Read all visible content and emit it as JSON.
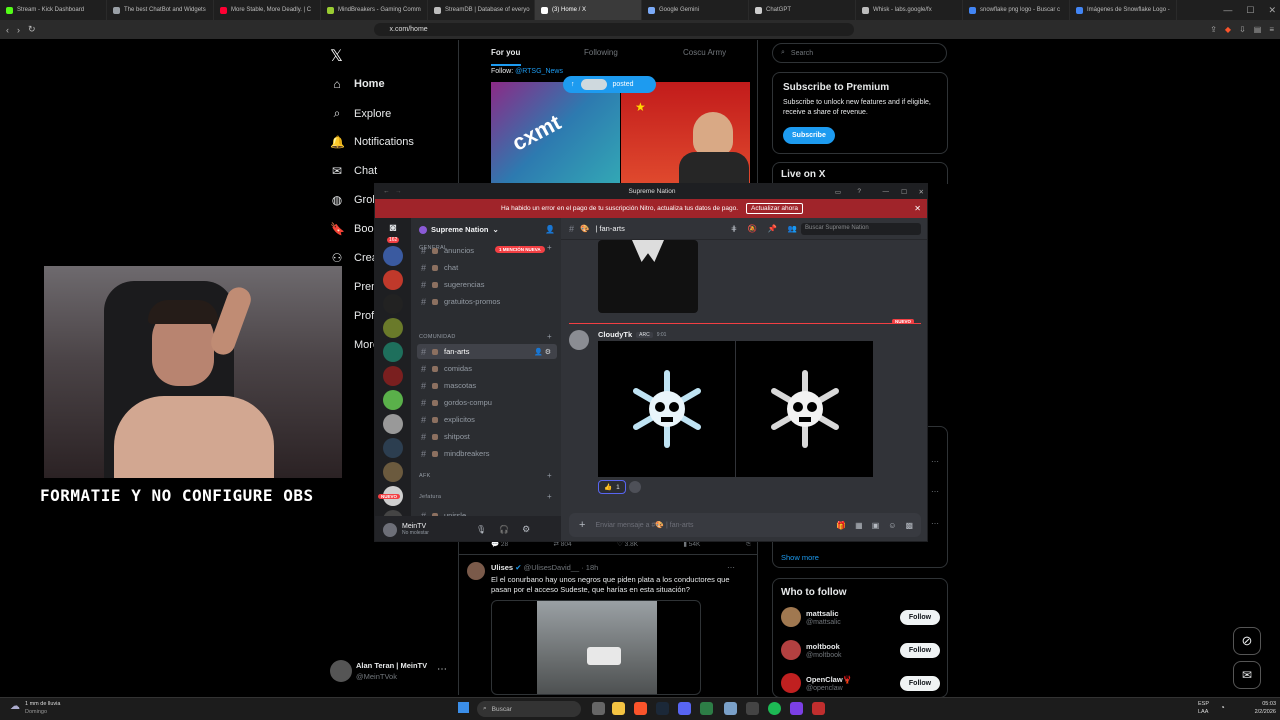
{
  "browser": {
    "tabs": [
      {
        "label": "Stream - Kick Dashboard",
        "color": "#53fc18"
      },
      {
        "label": "The best ChatBot and Widgets",
        "color": "#9aa0a6"
      },
      {
        "label": "More Stable, More Deadly. | C",
        "color": "#ff0033"
      },
      {
        "label": "MindBreakers - Gaming Comm",
        "color": "#9acd32"
      },
      {
        "label": "StreamDB | Database of everyo",
        "color": "#bdbdbd"
      },
      {
        "label": "(3) Home / X",
        "color": "#ffffff"
      },
      {
        "label": "Google Gemini",
        "color": "#7baaf7"
      },
      {
        "label": "ChatGPT",
        "color": "#cccccc"
      },
      {
        "label": "Whisk - labs.google/fx",
        "color": "#bdbdbd"
      },
      {
        "label": "snowflake png logo - Buscar c",
        "color": "#4285f4"
      },
      {
        "label": "Imágenes de Snowflake Logo -",
        "color": "#4285f4"
      }
    ],
    "url": "x.com/home"
  },
  "x": {
    "logo": "𝕏",
    "nav": [
      {
        "label": "Home",
        "icon": "home-icon",
        "glyph": "⌂"
      },
      {
        "label": "Explore",
        "icon": "search-icon",
        "glyph": "⌕"
      },
      {
        "label": "Notifications",
        "icon": "bell-icon",
        "glyph": "🔔"
      },
      {
        "label": "Chat",
        "icon": "mail-icon",
        "glyph": "✉"
      },
      {
        "label": "Grok",
        "icon": "grok-icon",
        "glyph": "◍"
      },
      {
        "label": "Book",
        "icon": "bookmark-icon",
        "glyph": "🔖"
      },
      {
        "label": "Crea",
        "icon": "communities-icon",
        "glyph": "⚇"
      },
      {
        "label": "Prem",
        "icon": "premium-icon",
        "glyph": "𝕏"
      },
      {
        "label": "Profi",
        "icon": "profile-icon",
        "glyph": "☺"
      },
      {
        "label": "More",
        "icon": "more-icon",
        "glyph": "⋯"
      }
    ],
    "account": {
      "name": "Alan Teran | MeinTV",
      "handle": "@MeinTVok"
    },
    "feed_tabs": [
      "For you",
      "Following",
      "Coscu Army"
    ],
    "follow_line": "Follow: ",
    "follow_handle": "@RTSG_News",
    "posted_pill": "posted",
    "tweet_stats": [
      "28",
      "804",
      "3.8K",
      "54K"
    ],
    "tweet2": {
      "name": "Ulises",
      "handle": "@UlisesDavid__ · 18h",
      "text": "El el conurbano hay unos negros que piden plata a los conductores que pasan por el acceso Sudeste, que harías en esta situación?"
    },
    "search_placeholder": "Search",
    "premium": {
      "title": "Subscribe to Premium",
      "text": "Subscribe to unlock new features and if eligible, receive a share of revenue.",
      "button": "Subscribe"
    },
    "live_title": "Live on X",
    "show_more": "Show more",
    "who_to_follow": {
      "title": "Who to follow",
      "follow_label": "Follow",
      "accounts": [
        {
          "name": "mattsalic",
          "handle": "@mattsalic"
        },
        {
          "name": "moltbook",
          "handle": "@moltbook"
        },
        {
          "name": "OpenClaw🦞",
          "handle": "@openclaw"
        }
      ]
    }
  },
  "stream": {
    "caption": "FORMATIE Y NO CONFIGURE OBS"
  },
  "discord": {
    "window_title": "Supreme Nation",
    "banner_text": "Ha habido un error en el pago de tu suscripción Nitro, actualiza tus datos de pago.",
    "banner_button": "Actualizar ahora",
    "server_name": "Supreme Nation",
    "badge_count": "162",
    "mention_pill": "1 MENCIÓN NUEVA",
    "categories": [
      "GENERAL",
      "COMUNIDAD",
      "AFK",
      "Jefatura"
    ],
    "general_channels": [
      "anuncios",
      "chat",
      "sugerencias",
      "gratuitos-promos"
    ],
    "comunidad_channels": [
      "fan-arts",
      "comidas",
      "mascotas",
      "gordos-compu",
      "explicitos",
      "shitpost",
      "mindbreakers"
    ],
    "extra_channel": "unirsle",
    "current_channel": "fan-arts",
    "search_placeholder": "Buscar Supreme Nation",
    "new_label": "NUEVO",
    "message": {
      "author": "CloudyTk",
      "tag": "ARC",
      "time": "9:01",
      "reaction_count": "1"
    },
    "composer_placeholder": "Enviar mensaje a #🎨 | fan-arts",
    "user": {
      "name": "MeinTV",
      "status": "No molestar"
    },
    "nuevo_pill": "NUEVO"
  },
  "taskbar": {
    "weather": "1 mm de lluvia",
    "weather_sub": "Domingo",
    "search": "Buscar",
    "lang": "ESP",
    "lang_sub": "LAA",
    "time": "05:03",
    "date": "2/2/2026"
  }
}
